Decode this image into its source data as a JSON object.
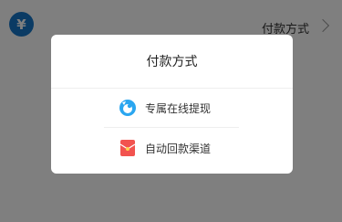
{
  "background": {
    "currency_icon": "yen-icon",
    "currency_symbol": "¥",
    "pay_method_label": "付款方式",
    "chevron_icon": "chevron-right-icon"
  },
  "dialog": {
    "title": "付款方式",
    "options": [
      {
        "label": "专属在线提现",
        "icon": "blue-bird-icon",
        "color": "#2aa6f0"
      },
      {
        "label": "自动回款渠道",
        "icon": "red-envelope-icon",
        "color": "#f2534f"
      }
    ]
  },
  "colors": {
    "overlay": "rgba(0,0,0,0.5)",
    "brand_blue": "#1777c9"
  }
}
